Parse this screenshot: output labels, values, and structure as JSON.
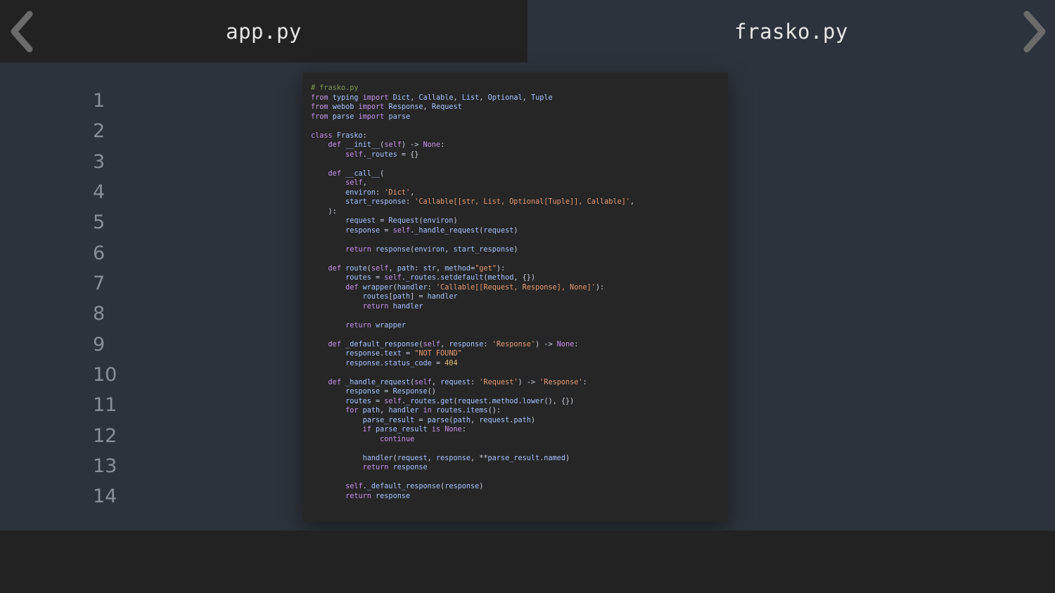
{
  "tabs": {
    "left": {
      "label": "app.py"
    },
    "right": {
      "label": "frasko.py"
    }
  },
  "nav": {
    "prev_icon": "chevron-left-icon",
    "next_icon": "chevron-right-icon"
  },
  "gutter": {
    "line_numbers": [
      "1",
      "2",
      "3",
      "4",
      "5",
      "6",
      "7",
      "8",
      "9",
      "10",
      "11",
      "12",
      "13",
      "14"
    ]
  },
  "code": {
    "filename_comment": "# frasko.py",
    "lines": [
      "# frasko.py",
      "from typing import Dict, Callable, List, Optional, Tuple",
      "from webob import Response, Request",
      "from parse import parse",
      "",
      "class Frasko:",
      "    def __init__(self) -> None:",
      "        self._routes = {}",
      "",
      "    def __call__(",
      "        self,",
      "        environ: 'Dict',",
      "        start_response: 'Callable[[str, List, Optional[Tuple]], Callable]',",
      "    ):",
      "        request = Request(environ)",
      "        response = self._handle_request(request)",
      "",
      "        return response(environ, start_response)",
      "",
      "    def route(self, path: str, method=\"get\"):",
      "        routes = self._routes.setdefault(method, {})",
      "        def wrapper(handler: 'Callable[[Request, Response], None]'):",
      "            routes[path] = handler",
      "            return handler",
      "",
      "        return wrapper",
      "",
      "    def _default_response(self, response: 'Response') -> None:",
      "        response.text = \"NOT FOUND\"",
      "        response.status_code = 404",
      "",
      "    def _handle_request(self, request: 'Request') -> 'Response':",
      "        response = Response()",
      "        routes = self._routes.get(request.method.lower(), {})",
      "        for path, handler in routes.items():",
      "            parse_result = parse(path, request.path)",
      "            if parse_result is None:",
      "                continue",
      "",
      "            handler(request, response, **parse_result.named)",
      "            return response",
      "",
      "        self._default_response(response)",
      "        return response"
    ]
  },
  "colors": {
    "background": "#2d333c",
    "active_tab": "#222222",
    "code_bg": "#262626",
    "comment": "#7f9a56",
    "keyword": "#c792ea",
    "string": "#e59b74",
    "number": "#d9c07a"
  }
}
